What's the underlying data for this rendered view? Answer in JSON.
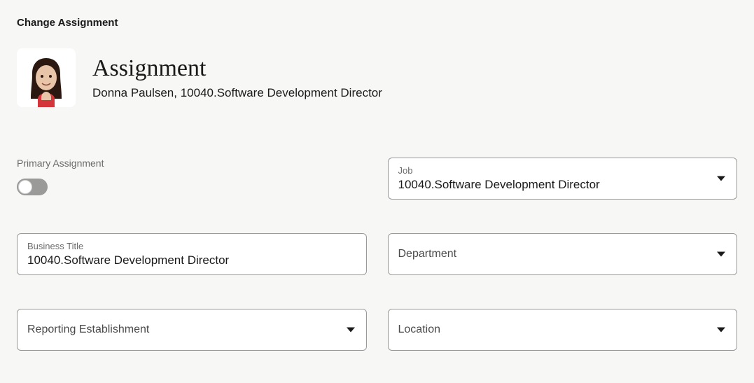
{
  "breadcrumb": "Change Assignment",
  "header": {
    "title": "Assignment",
    "subtitle": "Donna Paulsen, 10040.Software Development Director"
  },
  "fields": {
    "primary_assignment": {
      "label": "Primary Assignment",
      "value": false
    },
    "job": {
      "label": "Job",
      "value": "10040.Software Development Director"
    },
    "business_title": {
      "label": "Business Title",
      "value": "10040.Software Development Director"
    },
    "department": {
      "label": "Department",
      "value": ""
    },
    "reporting_establishment": {
      "label": "Reporting Establishment",
      "value": ""
    },
    "location": {
      "label": "Location",
      "value": ""
    }
  }
}
